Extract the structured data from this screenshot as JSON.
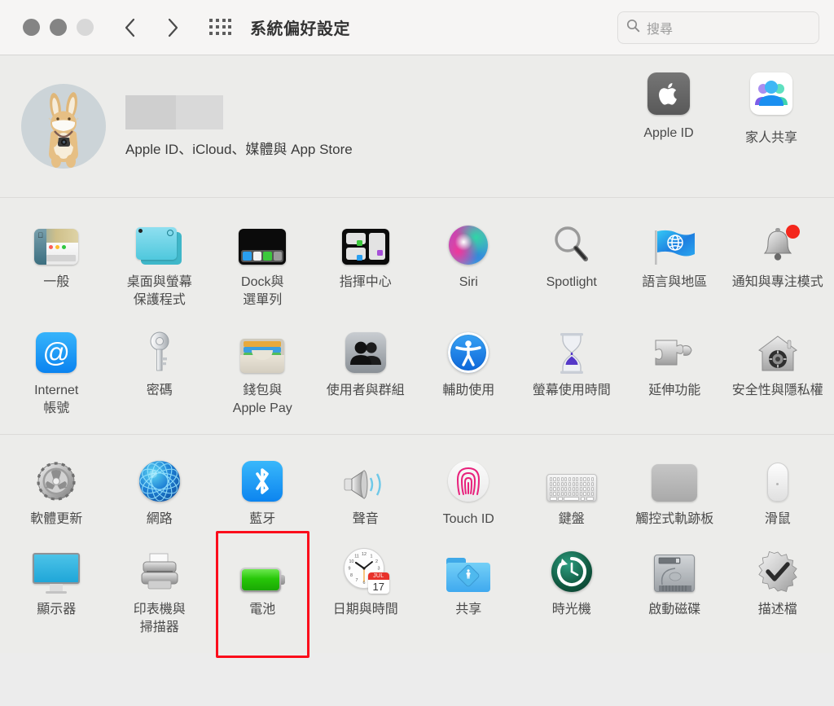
{
  "window": {
    "title": "系統偏好設定",
    "traffic_lights": [
      "close",
      "minimize",
      "zoom"
    ]
  },
  "toolbar": {
    "back_label": "‹",
    "forward_label": "›",
    "grid_label": "顯示全部",
    "search": {
      "placeholder": "搜尋",
      "value": ""
    }
  },
  "account": {
    "avatar_alt": "rabbit-avatar",
    "name_redacted": true,
    "subtitle": "Apple ID、iCloud、媒體與 App Store",
    "items": [
      {
        "label": "Apple ID",
        "icon": "apple-logo-icon"
      },
      {
        "label": "家人共享",
        "icon": "family-sharing-icon"
      }
    ]
  },
  "sections": [
    {
      "id": "personal",
      "panes": [
        {
          "label": "一般",
          "icon": "general-icon"
        },
        {
          "label": "桌面與螢幕\n保護程式",
          "icon": "desktop-screensaver-icon"
        },
        {
          "label": "Dock與\n選單列",
          "icon": "dock-menubar-icon"
        },
        {
          "label": "指揮中心",
          "icon": "mission-control-icon"
        },
        {
          "label": "Siri",
          "icon": "siri-icon"
        },
        {
          "label": "Spotlight",
          "icon": "spotlight-icon"
        },
        {
          "label": "語言與地區",
          "icon": "language-region-icon"
        },
        {
          "label": "通知與專注模式",
          "icon": "notifications-focus-icon"
        },
        {
          "label": "Internet\n帳號",
          "icon": "internet-accounts-icon"
        },
        {
          "label": "密碼",
          "icon": "passwords-key-icon"
        },
        {
          "label": "錢包與\nApple Pay",
          "icon": "wallet-applepay-icon"
        },
        {
          "label": "使用者與群組",
          "icon": "users-groups-icon"
        },
        {
          "label": "輔助使用",
          "icon": "accessibility-icon"
        },
        {
          "label": "螢幕使用時間",
          "icon": "screen-time-icon"
        },
        {
          "label": "延伸功能",
          "icon": "extensions-puzzle-icon"
        },
        {
          "label": "安全性與隱私權",
          "icon": "security-privacy-icon"
        }
      ]
    },
    {
      "id": "hardware",
      "panes": [
        {
          "label": "軟體更新",
          "icon": "software-update-icon"
        },
        {
          "label": "網路",
          "icon": "network-globe-icon"
        },
        {
          "label": "藍牙",
          "icon": "bluetooth-icon"
        },
        {
          "label": "聲音",
          "icon": "sound-speaker-icon"
        },
        {
          "label": "Touch ID",
          "icon": "touch-id-icon"
        },
        {
          "label": "鍵盤",
          "icon": "keyboard-icon"
        },
        {
          "label": "觸控式軌跡板",
          "icon": "trackpad-icon"
        },
        {
          "label": "滑鼠",
          "icon": "mouse-icon"
        },
        {
          "label": "顯示器",
          "icon": "displays-icon"
        },
        {
          "label": "印表機與\n掃描器",
          "icon": "printers-scanners-icon"
        },
        {
          "label": "電池",
          "icon": "battery-icon",
          "highlighted": true
        },
        {
          "label": "日期與時間",
          "icon": "date-time-icon"
        },
        {
          "label": "共享",
          "icon": "sharing-folder-icon"
        },
        {
          "label": "時光機",
          "icon": "time-machine-icon"
        },
        {
          "label": "啟動磁碟",
          "icon": "startup-disk-icon"
        },
        {
          "label": "描述檔",
          "icon": "profiles-icon"
        }
      ]
    }
  ],
  "date_time_icon": {
    "month": "JUL",
    "day": "17"
  },
  "colors": {
    "highlight": "#fb0d1b",
    "toolbar_bg": "#f6f5f4",
    "content_bg": "#ececea",
    "label_text": "#4a4a4a",
    "accent_blue": "#0a83f0",
    "battery_green": "#27c708"
  }
}
